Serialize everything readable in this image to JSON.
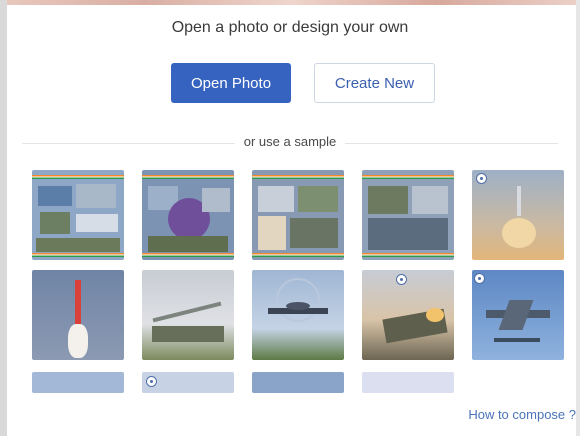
{
  "header": {
    "title": "Open a photo or design your own"
  },
  "actions": {
    "open_photo": "Open Photo",
    "create_new": "Create New"
  },
  "samples": {
    "divider_label": "or use a sample"
  },
  "footer": {
    "help_link": "How to compose ?"
  },
  "colors": {
    "primary": "#3763c0",
    "link": "#4a73b8"
  }
}
